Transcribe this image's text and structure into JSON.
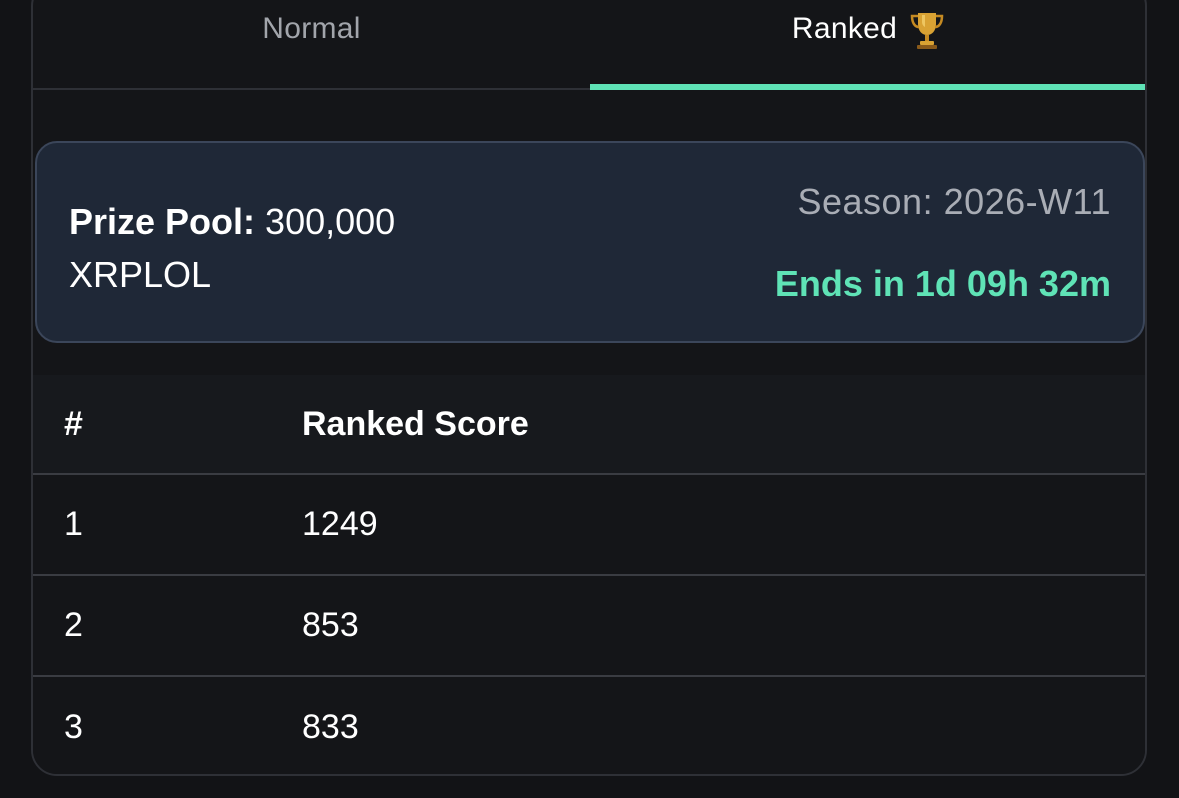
{
  "tabs": [
    {
      "label": "Normal",
      "active": false
    },
    {
      "label": "Ranked",
      "active": true,
      "icon": "trophy-icon"
    }
  ],
  "prize": {
    "label": "Prize Pool:",
    "amount": "300,000",
    "currency": "XRPLOL",
    "season": "Season: 2026-W11",
    "ends": "Ends in 1d 09h 32m"
  },
  "table": {
    "headers": {
      "rank": "#",
      "score": "Ranked Score"
    },
    "rows": [
      {
        "rank": "1",
        "score": "1249"
      },
      {
        "rank": "2",
        "score": "853"
      },
      {
        "rank": "3",
        "score": "833"
      }
    ]
  },
  "colors": {
    "accent": "#5fe3b6",
    "card_bg": "#1f2837",
    "page_bg": "#121316"
  }
}
